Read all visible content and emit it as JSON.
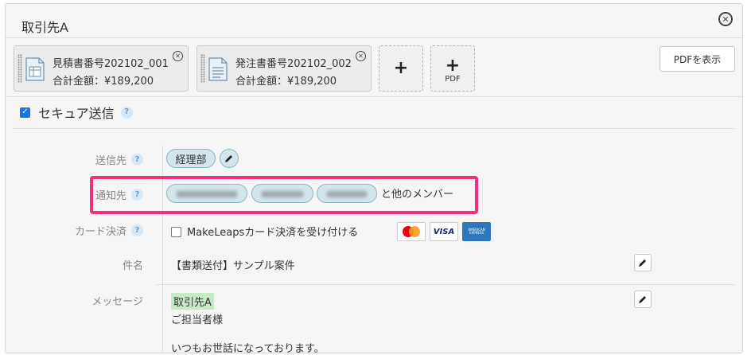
{
  "header": {
    "title": "取引先A"
  },
  "documents": [
    {
      "name": "見積書番号202102_001",
      "total": "合計金額：¥189,200"
    },
    {
      "name": "発注書番号202102_002",
      "total": "合計金額：¥189,200"
    }
  ],
  "add_buttons": {
    "plus": "+",
    "pdf_label": "PDF"
  },
  "toolbar": {
    "pdf_view": "PDFを表示"
  },
  "secure": {
    "label": "セキュア送信",
    "help": "?"
  },
  "form": {
    "to_label": "送信先",
    "notify_label": "通知先",
    "card_label": "カード決済",
    "subject_label": "件名",
    "message_label": "メッセージ",
    "help": "?"
  },
  "recipients": {
    "to_tag": "経理部"
  },
  "notify": {
    "others_text": "と他のメンバー"
  },
  "card": {
    "accept_text": "MakeLeapsカード決済を受け付ける",
    "brands": [
      "MasterCard",
      "VISA",
      "AMERICAN EXPRESS"
    ],
    "colors": {
      "mastercard_red": "#eb001b",
      "mastercard_orange": "#f79e1b",
      "visa_blue": "#1a1f71",
      "amex_blue": "#2e77bb"
    }
  },
  "subject": {
    "value": "【書類送付】サンプル案件"
  },
  "message": {
    "recipient_name": "取引先A",
    "line1": "ご担当者様",
    "line2": "いつもお世話になっております。"
  },
  "colors": {
    "highlight": "#f0307a",
    "accent": "#1a73e8",
    "tag_bg": "#d4e6ec"
  }
}
